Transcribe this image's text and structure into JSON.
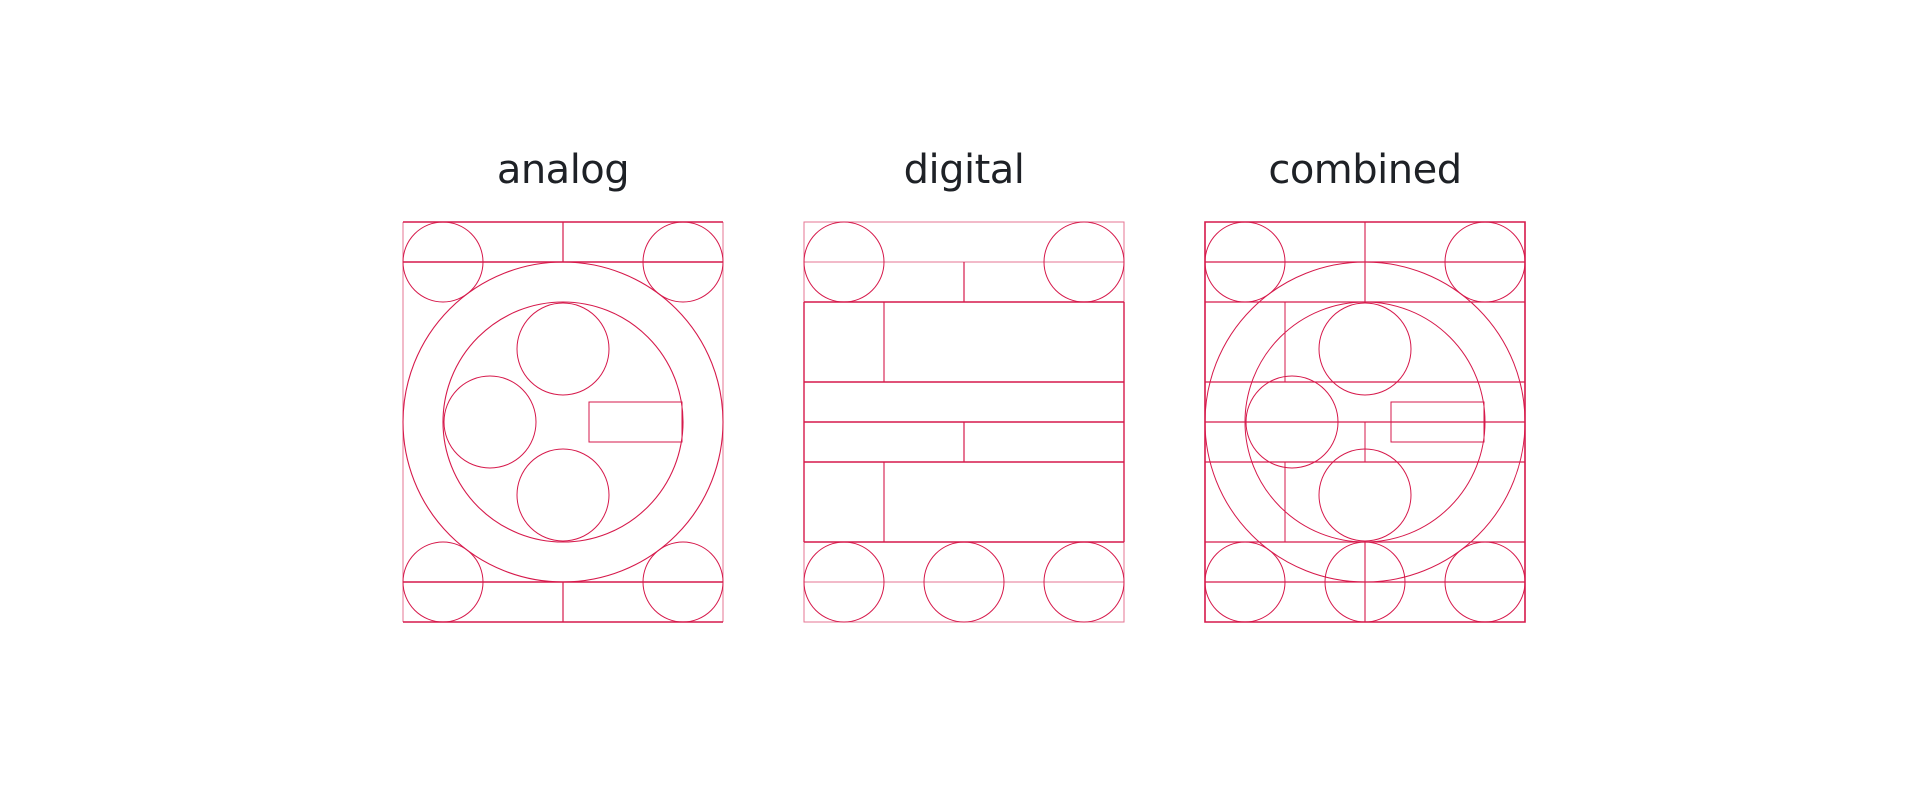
{
  "colors": {
    "stroke": "#d6194b",
    "title": "#1e2126",
    "background": "#ffffff"
  },
  "panels": [
    {
      "title": "analog"
    },
    {
      "title": "digital"
    },
    {
      "title": "combined"
    }
  ]
}
